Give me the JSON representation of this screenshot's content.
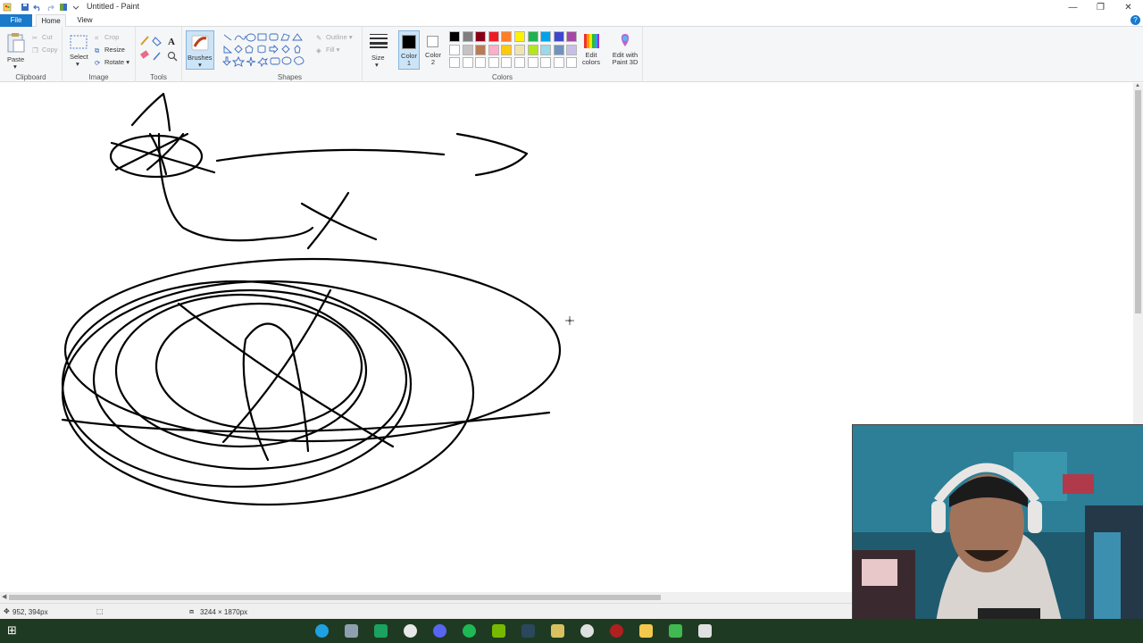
{
  "window": {
    "title": "Untitled - Paint",
    "minimize_glyph": "—",
    "restore_glyph": "❐",
    "close_glyph": "✕"
  },
  "tabs": {
    "file": "File",
    "home": "Home",
    "view": "View"
  },
  "help_glyph": "?",
  "ribbon": {
    "clipboard": {
      "paste": "Paste",
      "cut": "Cut",
      "copy": "Copy",
      "label": "Clipboard"
    },
    "image": {
      "select": "Select",
      "crop": "Crop",
      "resize": "Resize",
      "rotate": "Rotate",
      "label": "Image"
    },
    "tools": {
      "label": "Tools"
    },
    "brushes": {
      "label": "Brushes"
    },
    "shapes": {
      "outline": "Outline",
      "fill": "Fill",
      "label": "Shapes"
    },
    "size": {
      "label": "Size"
    },
    "color1": {
      "label": "Color 1",
      "color": "#000000"
    },
    "color2": {
      "label": "Color 2",
      "color": "#ffffff"
    },
    "colors": {
      "label": "Colors",
      "edit_colors": "Edit colors",
      "edit_paint3d": "Edit with Paint 3D",
      "palette_row1": [
        "#000000",
        "#7f7f7f",
        "#880015",
        "#ed1c24",
        "#ff7f27",
        "#fff200",
        "#22b14c",
        "#00a2e8",
        "#3f48cc",
        "#a349a4"
      ],
      "palette_row2": [
        "#ffffff",
        "#c3c3c3",
        "#b97a57",
        "#ffaec9",
        "#ffc90e",
        "#efe4b0",
        "#b5e61d",
        "#99d9ea",
        "#7092be",
        "#c8bfe7"
      ]
    }
  },
  "status": {
    "cursor_pos": "952, 394px",
    "canvas_size": "3244 × 1870px"
  },
  "taskbar": {
    "start_glyph": "⊞",
    "icons": [
      "edge-icon",
      "mail-icon",
      "calendar-icon",
      "chrome-icon",
      "discord-icon",
      "spotify-icon",
      "nvidia-icon",
      "steam-icon",
      "paint-icon",
      "obs-icon",
      "record-icon",
      "folder-icon",
      "terminal-icon",
      "monitor-icon"
    ]
  }
}
